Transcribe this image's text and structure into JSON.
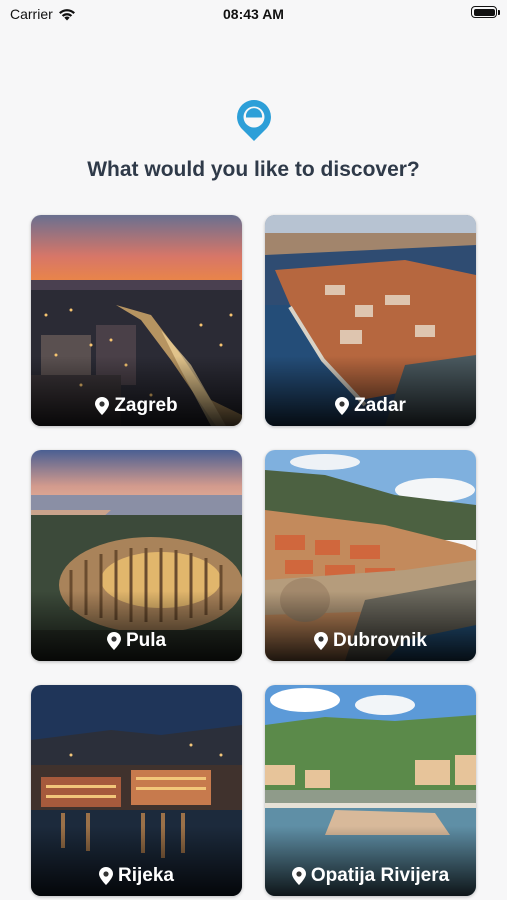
{
  "status_bar": {
    "carrier": "Carrier",
    "time": "08:43 AM",
    "icons": [
      "wifi-icon",
      "battery-icon"
    ]
  },
  "header": {
    "logo_icon": "e-location-pin-logo",
    "title": "What would you like to discover?"
  },
  "colors": {
    "accent": "#2d9fd8",
    "title_text": "#2f3a49",
    "background": "#f7f7f8"
  },
  "destinations": [
    {
      "name": "Zagreb"
    },
    {
      "name": "Zadar"
    },
    {
      "name": "Pula"
    },
    {
      "name": "Dubrovnik"
    },
    {
      "name": "Rijeka"
    },
    {
      "name": "Opatija Rivijera"
    }
  ]
}
